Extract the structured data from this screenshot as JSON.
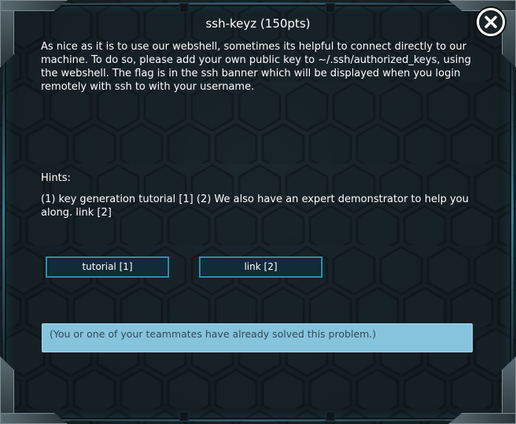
{
  "problem": {
    "title": "ssh-keyz (150pts)",
    "description": "As nice as it is to use our webshell, sometimes its helpful to connect directly to our machine. To do so, please add your own public key to ~/.ssh/authorized_keys, using the webshell. The flag is in the ssh banner which will be displayed when you login remotely with ssh to  with your username.",
    "hints_label": "Hints:",
    "hints_text": "(1) key generation tutorial [1]  (2) We also have an expert demonstrator to help you along. link [2]"
  },
  "buttons": {
    "tutorial_label": "tutorial [1]",
    "link_label": "link [2]"
  },
  "status": {
    "solved_message": "(You or one of your teammates have already solved this problem.)"
  },
  "icons": {
    "close": "close-icon"
  },
  "colors": {
    "panel_bg": "#141d22",
    "button_border": "#2c8fb0",
    "button_bg": "#0f2c38",
    "solved_bg": "#86c4dd",
    "solved_text": "#2f4a55"
  }
}
